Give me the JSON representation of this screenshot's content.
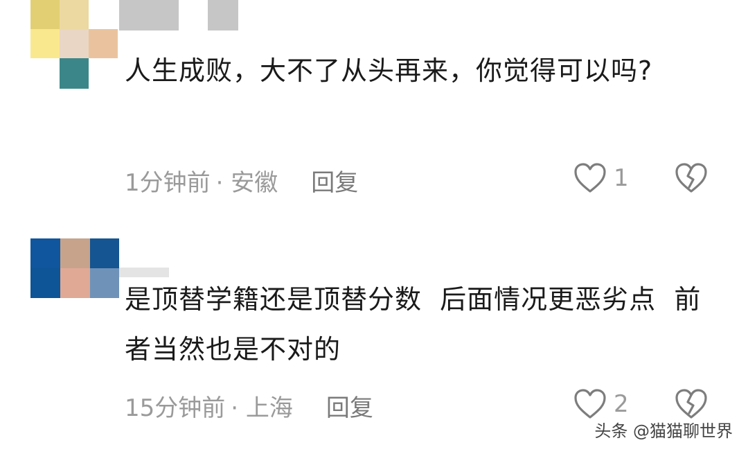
{
  "comments": [
    {
      "text": "人生成败，大不了从头再来，你觉得可以吗?",
      "time": "1分钟前",
      "location": "· 安徽",
      "reply_label": "回复",
      "likes": "1",
      "avatar_colors": [
        "#e2cf74",
        "#ecd9a2",
        "#ffffff",
        "#fae88e",
        "#ead6c4",
        "#eac39e",
        "#ffffff",
        "#3b8688",
        "#ffffff"
      ]
    },
    {
      "text": "是顶替学籍还是顶替分数  后面情况更恶劣点  前者当然也是不对的",
      "time": "15分钟前",
      "location": "· 上海",
      "reply_label": "回复",
      "likes": "2",
      "avatar_colors": [
        "#10569e",
        "#c7a38c",
        "#155591",
        "#0d5596",
        "#e0a996",
        "#6f92b8"
      ]
    }
  ],
  "watermark": "头条 @猫猫聊世界",
  "colors": {
    "text": "#1a1a1a",
    "meta": "#9a9a9a",
    "icon": "#7d7d7d",
    "name_blur": "#c6c6c6"
  },
  "icons": {
    "like": "heart-outline-icon",
    "dislike": "broken-heart-icon"
  }
}
